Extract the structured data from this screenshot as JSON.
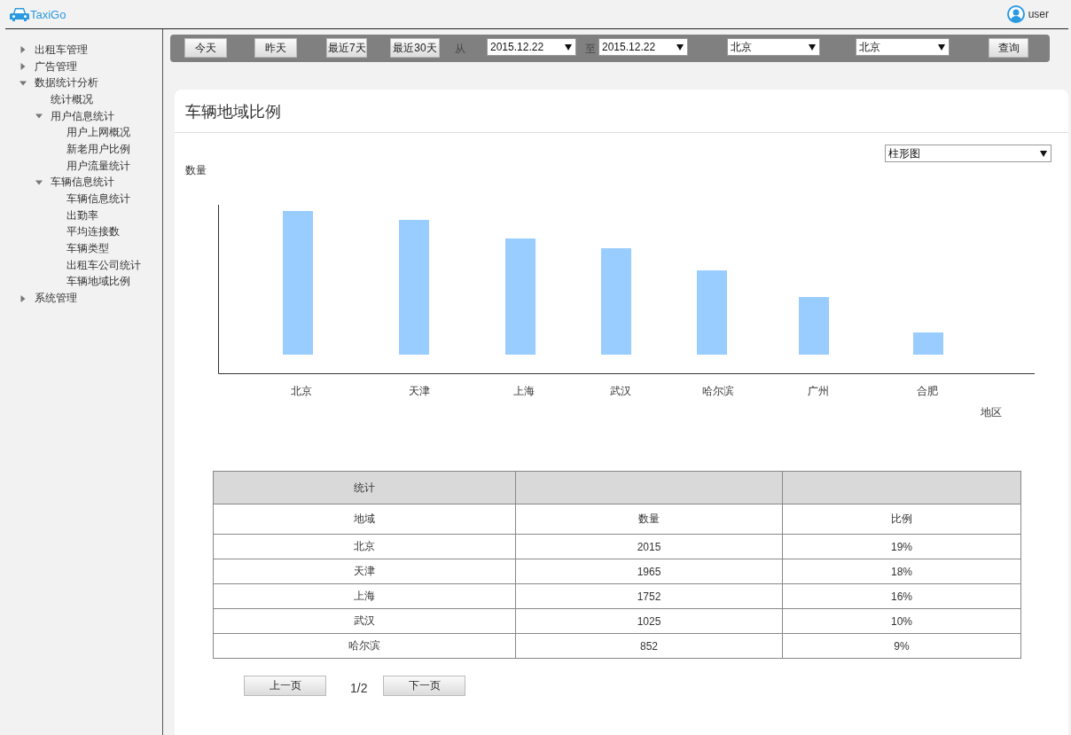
{
  "header": {
    "logo_text": "TaxiGo",
    "user": "user"
  },
  "sidebar": {
    "items": [
      {
        "label": "出租车管理",
        "expanded": false
      },
      {
        "label": "广告管理",
        "expanded": false
      },
      {
        "label": "数据统计分析",
        "expanded": true,
        "children": [
          {
            "label": "统计概况"
          },
          {
            "label": "用户信息统计",
            "expanded": true,
            "children": [
              {
                "label": "用户上网概况"
              },
              {
                "label": "新老用户比例"
              },
              {
                "label": "用户流量统计"
              }
            ]
          },
          {
            "label": "车辆信息统计",
            "expanded": true,
            "children": [
              {
                "label": "车辆信息统计"
              },
              {
                "label": "出勤率"
              },
              {
                "label": "平均连接数"
              },
              {
                "label": "车辆类型"
              },
              {
                "label": "出租车公司统计"
              },
              {
                "label": "车辆地域比例"
              }
            ]
          }
        ]
      },
      {
        "label": "系统管理",
        "expanded": false
      }
    ]
  },
  "toolbar": {
    "range_buttons": [
      "今天",
      "昨天",
      "最近7天",
      "最近30天"
    ],
    "from_label": "从",
    "date_from": "2015.12.22",
    "to_label": "至",
    "date_to": "2015.12.22",
    "city_1": "北京",
    "city_2": "北京",
    "query_button": "查询"
  },
  "card": {
    "title": "车辆地域比例",
    "chart_type": "柱形图",
    "chart": {
      "ylabel": "数量",
      "xlabel": "地区",
      "categories": [
        "北京",
        "天津",
        "上海",
        "武汉",
        "哈尔滨",
        "广州",
        "合肥"
      ]
    },
    "table": {
      "group_header": "统计",
      "columns": [
        "地域",
        "数量",
        "比例"
      ],
      "rows": [
        [
          "北京",
          "2015",
          "19%"
        ],
        [
          "天津",
          "1965",
          "18%"
        ],
        [
          "上海",
          "1752",
          "16%"
        ],
        [
          "武汉",
          "1025",
          "10%"
        ],
        [
          "哈尔滨",
          "852",
          "9%"
        ]
      ]
    },
    "pagination": {
      "prev": "上一页",
      "page": "1/2",
      "next": "下一页"
    }
  }
}
